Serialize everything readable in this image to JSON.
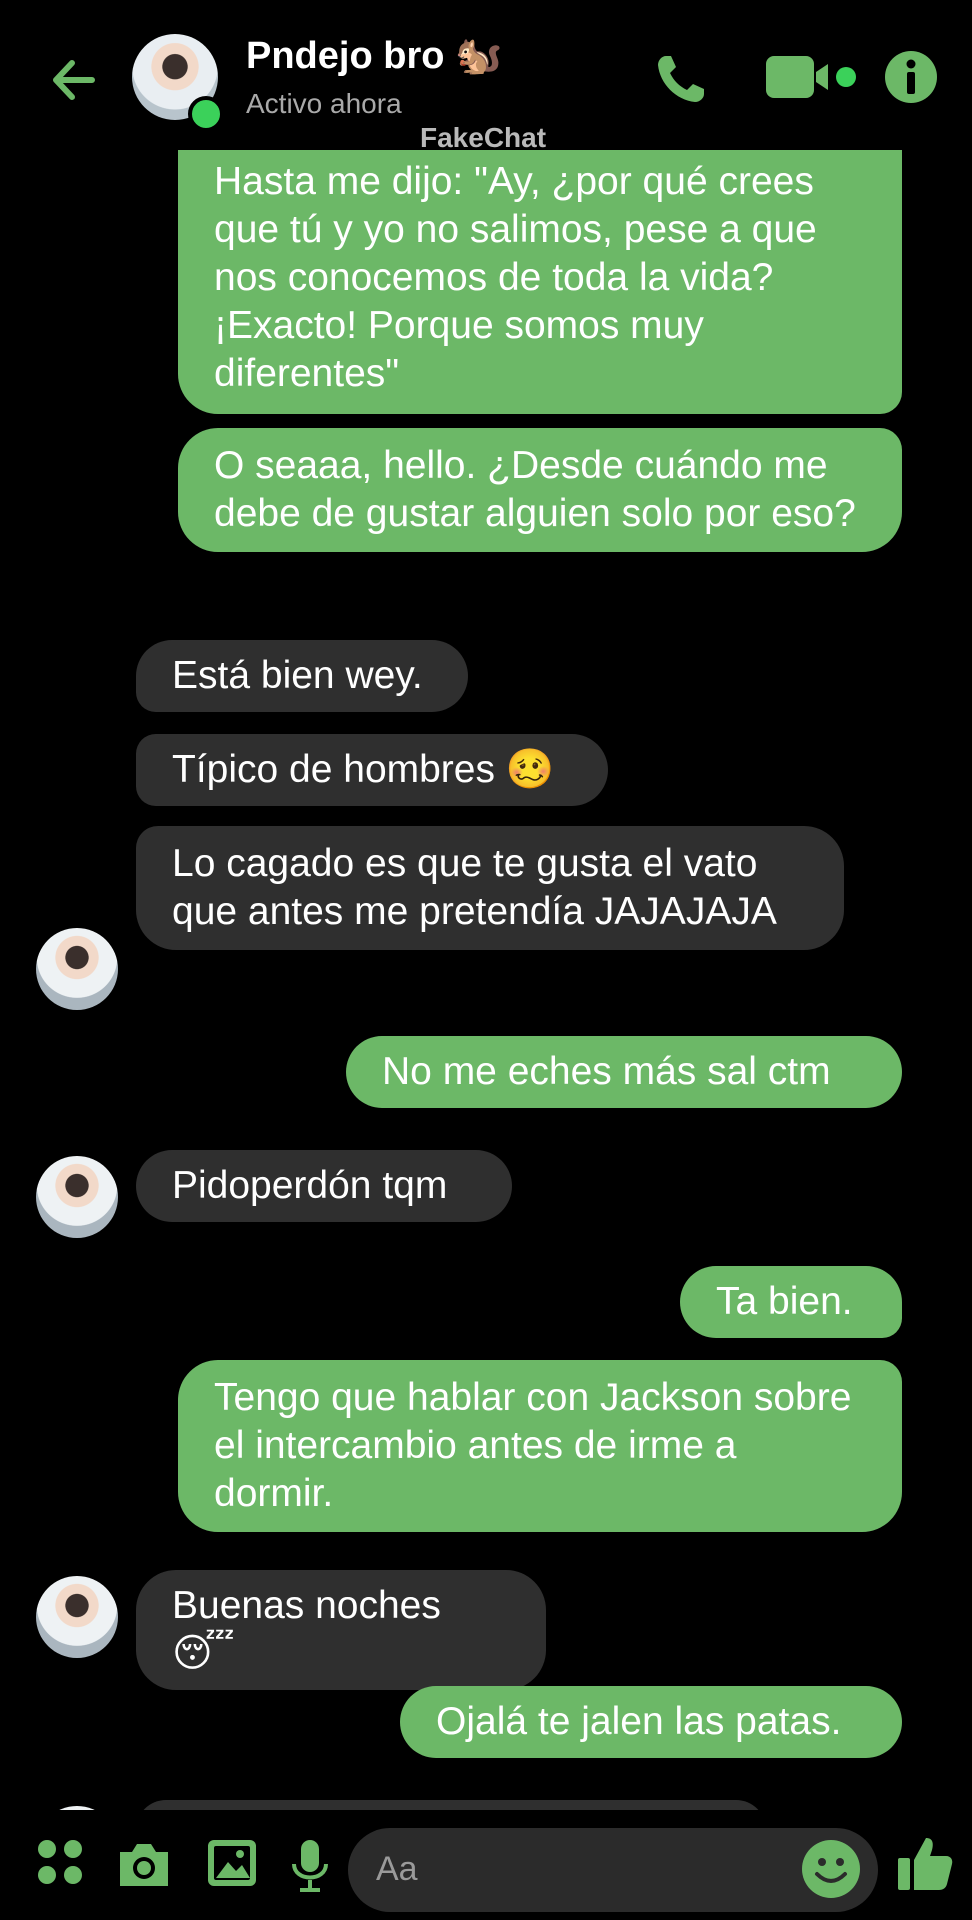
{
  "header": {
    "contact_name": "Pndejo bro 🐿️",
    "status": "Activo ahora",
    "watermark": "FakeChat",
    "icons": [
      "back-arrow-icon",
      "phone-icon",
      "video-call-icon",
      "info-icon"
    ]
  },
  "messages": [
    {
      "from": "me",
      "text": "Hasta me dijo: \"Ay, ¿por qué crees que tú y yo no salimos, pese a que nos conocemos de toda la vida? ¡Exacto! Porque somos muy diferentes\""
    },
    {
      "from": "me",
      "text": "O seaaa, hello. ¿Desde cuándo me debe de gustar alguien solo por eso?"
    },
    {
      "from": "them",
      "text": "Está bien wey."
    },
    {
      "from": "them",
      "text": "Típico de hombres 🥴"
    },
    {
      "from": "them",
      "text": "Lo cagado es que te gusta el vato que antes me pretendía JAJAJAJA"
    },
    {
      "from": "me",
      "text": "No me eches más sal ctm"
    },
    {
      "from": "them",
      "text": "Pidoperdón tqm"
    },
    {
      "from": "me",
      "text": "Ta bien."
    },
    {
      "from": "me",
      "text": "Tengo que hablar con Jackson sobre el intercambio antes de irme a dormir."
    },
    {
      "from": "them",
      "text": "Buenas noches 😴"
    },
    {
      "from": "me",
      "text": "Ojalá te jalen las patas."
    }
  ],
  "composer": {
    "placeholder": "Aa",
    "icons": [
      "apps-grid-icon",
      "camera-icon",
      "gallery-icon",
      "microphone-icon",
      "emoji-smile-icon",
      "thumbs-up-icon"
    ]
  },
  "colors": {
    "accent": "#6cb867",
    "background": "#000000",
    "incoming_bubble": "#2f2f2f",
    "online": "#3bd15a"
  }
}
